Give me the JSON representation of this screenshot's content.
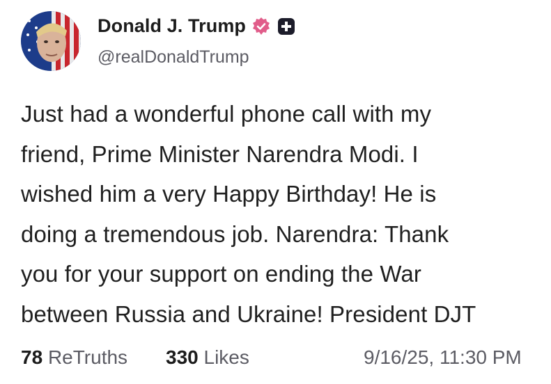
{
  "author": {
    "display_name": "Donald J. Trump",
    "handle": "@realDonaldTrump",
    "avatar_icon": "profile-avatar",
    "verified_icon": "verified-badge-icon",
    "plus_icon": "plus-badge-icon",
    "verified_color": "#e15d8a"
  },
  "post": {
    "lines": [
      "Just had a wonderful phone call with my",
      "friend, Prime Minister Narendra Modi. I",
      "wished him a very Happy Birthday! He is",
      "doing a tremendous job. Narendra: Thank",
      "you for your support on ending the War",
      "between Russia and Ukraine! President DJT"
    ]
  },
  "stats": {
    "retruths_count": "78",
    "retruths_label": "ReTruths",
    "likes_count": "330",
    "likes_label": "Likes",
    "timestamp": "9/16/25, 11:30 PM"
  }
}
